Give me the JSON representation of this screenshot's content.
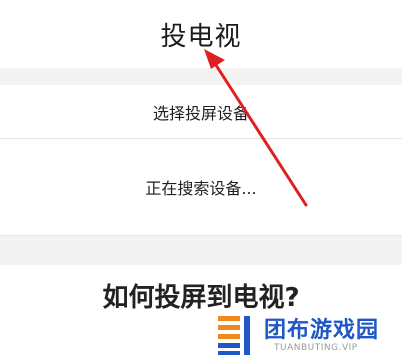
{
  "header": {
    "title": "投电视"
  },
  "cast_menu": {
    "select_device_label": "选择投屏设备",
    "searching_label": "正在搜索设备..."
  },
  "article": {
    "headline": "如何投屏到电视?"
  },
  "annotation": {
    "arrow_color": "#e02020"
  },
  "watermark": {
    "brand_name": "团布游戏园",
    "brand_url": "TUANBUTING.VIP",
    "logo_colors": [
      "#f08a1c",
      "#1f57c7"
    ]
  }
}
